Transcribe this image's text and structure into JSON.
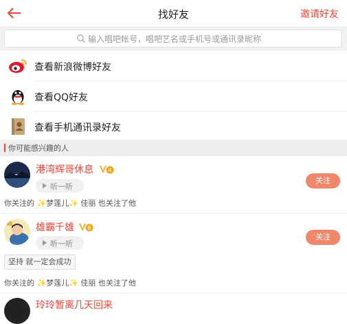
{
  "header": {
    "title": "找好友",
    "invite_label": "邀请好友",
    "back_icon": "back-arrow-icon",
    "accent_color": "#e8463a"
  },
  "search": {
    "placeholder": "输入唱吧帐号，唱吧艺名或手机号或通讯录昵称"
  },
  "menu": [
    {
      "label": "查看新浪微博好友",
      "icon": "weibo-icon"
    },
    {
      "label": "查看QQ好友",
      "icon": "qq-penguin-icon"
    },
    {
      "label": "查看手机通讯录好友",
      "icon": "contacts-book-icon"
    }
  ],
  "section": {
    "title": "你可能感兴趣的人"
  },
  "users": [
    {
      "name": "港湾辉哥休息",
      "listen_label": "听一听",
      "follow_label": "关注",
      "mutual_prefix": "你关注的 ",
      "mutual_name": "梦莲儿",
      "mutual_sep": " 佳丽 ",
      "mutual_suffix": "也关注了他"
    },
    {
      "name": "雄霸千雄",
      "listen_label": "听一听",
      "follow_label": "关注",
      "tag": "坚持 就一定会成功",
      "mutual_prefix": "你关注的 ",
      "mutual_name": "梦莲儿",
      "mutual_sep": " 佳丽 ",
      "mutual_suffix": "也关注了他"
    },
    {
      "name": "玲玲暂离几天回来"
    }
  ]
}
